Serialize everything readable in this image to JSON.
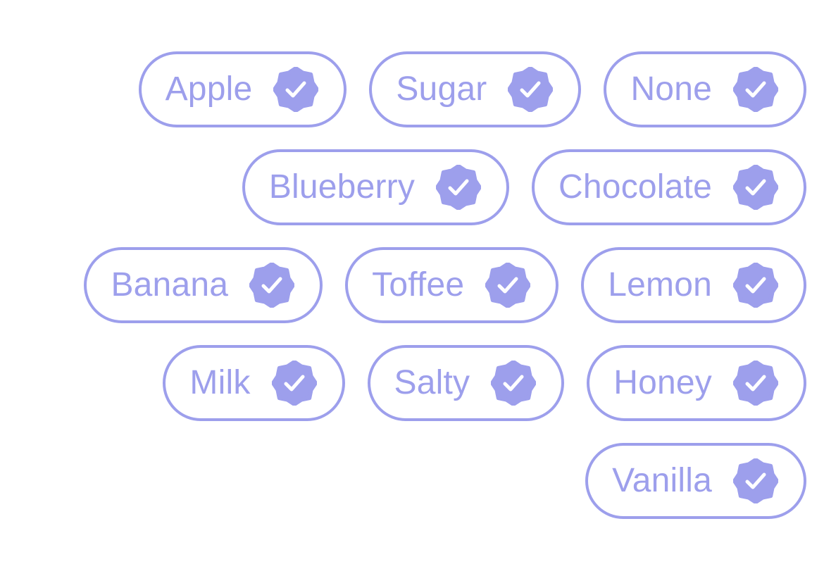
{
  "accent_color": "#9d9fec",
  "background_color": "#ffffff",
  "chip_icon": "verified-badge-check-icon",
  "chips": [
    {
      "label": "Apple",
      "selected": true
    },
    {
      "label": "Sugar",
      "selected": true
    },
    {
      "label": "None",
      "selected": true
    },
    {
      "label": "Blueberry",
      "selected": true
    },
    {
      "label": "Chocolate",
      "selected": true
    },
    {
      "label": "Banana",
      "selected": true
    },
    {
      "label": "Toffee",
      "selected": true
    },
    {
      "label": "Lemon",
      "selected": true
    },
    {
      "label": "Milk",
      "selected": true
    },
    {
      "label": "Salty",
      "selected": true
    },
    {
      "label": "Honey",
      "selected": true
    },
    {
      "label": "Vanilla",
      "selected": true
    }
  ]
}
